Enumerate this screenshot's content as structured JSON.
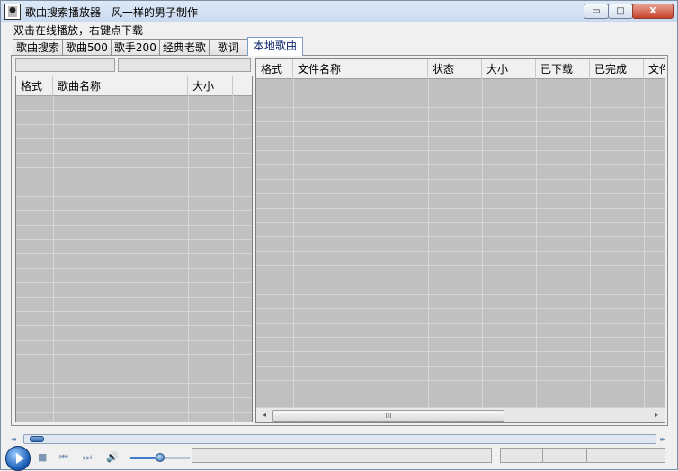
{
  "window": {
    "title": "歌曲搜索播放器  - 风一样的男子制作",
    "minimize_glyph": "▭",
    "maximize_glyph": "□",
    "close_glyph": "X"
  },
  "hint_text": "双击在线播放，右键点下载",
  "tabs": [
    {
      "label": "歌曲搜索"
    },
    {
      "label": "歌曲500"
    },
    {
      "label": "歌手200"
    },
    {
      "label": "经典老歌"
    },
    {
      "label": "歌词"
    },
    {
      "label": "本地歌曲"
    }
  ],
  "active_tab": "本地歌曲",
  "left_list": {
    "columns": [
      "格式",
      "歌曲名称",
      "大小"
    ]
  },
  "right_list": {
    "columns": [
      "格式",
      "文件名称",
      "状态",
      "大小",
      "已下载",
      "已完成",
      "文件"
    ]
  },
  "scrollbar": {
    "left_arrow": "◂",
    "right_arrow": "▸",
    "grip": "III"
  },
  "player": {
    "seek_left_arrows": "◂◂",
    "seek_right_arrows": "▸▸",
    "stop_glyph": "■",
    "prev_glyph": "⏮",
    "next_glyph": "⏭",
    "volume_glyph": "🔊",
    "volume_level_percent": 50,
    "seek_position_percent": 0
  }
}
